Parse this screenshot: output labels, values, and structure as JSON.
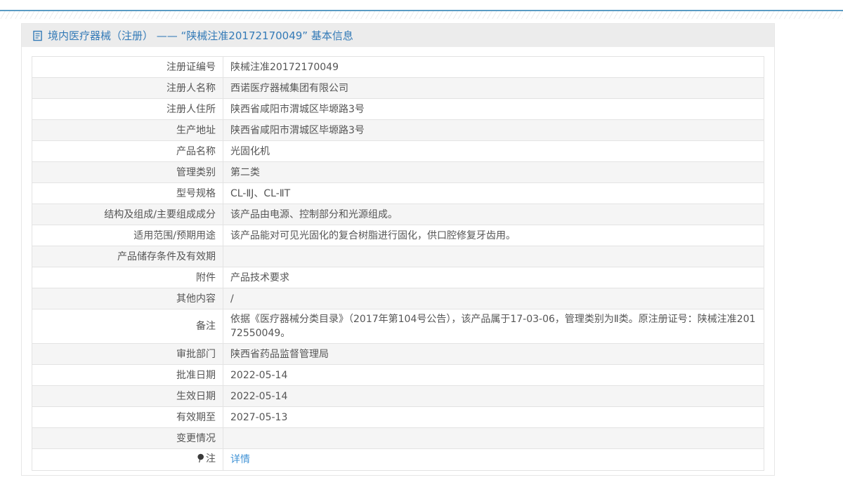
{
  "header": {
    "title": "境内医疗器械（注册） —— “陕械注准20172170049” 基本信息",
    "icon": "document-icon"
  },
  "table": {
    "rows": [
      {
        "label": "注册证编号",
        "value": "陕械注准20172170049"
      },
      {
        "label": "注册人名称",
        "value": "西诺医疗器械集团有限公司"
      },
      {
        "label": "注册人住所",
        "value": "陕西省咸阳市渭城区毕塬路3号"
      },
      {
        "label": "生产地址",
        "value": "陕西省咸阳市渭城区毕塬路3号"
      },
      {
        "label": "产品名称",
        "value": "光固化机"
      },
      {
        "label": "管理类别",
        "value": "第二类"
      },
      {
        "label": "型号规格",
        "value": "CL-ⅡJ、CL-ⅡT"
      },
      {
        "label": "结构及组成/主要组成成分",
        "value": "该产品由电源、控制部分和光源组成。"
      },
      {
        "label": "适用范围/预期用途",
        "value": "该产品能对可见光固化的复合树脂进行固化，供口腔修复牙齿用。"
      },
      {
        "label": "产品储存条件及有效期",
        "value": ""
      },
      {
        "label": "附件",
        "value": "产品技术要求"
      },
      {
        "label": "其他内容",
        "value": "/"
      },
      {
        "label": "备注",
        "value": "依据《医疗器械分类目录》（2017年第104号公告），该产品属于17-03-06，管理类别为Ⅱ类。原注册证号：陕械注准20172550049。"
      },
      {
        "label": "审批部门",
        "value": "陕西省药品监督管理局"
      },
      {
        "label": "批准日期",
        "value": "2022-05-14"
      },
      {
        "label": "生效日期",
        "value": "2022-05-14"
      },
      {
        "label": "有效期至",
        "value": "2027-05-13"
      },
      {
        "label": "变更情况",
        "value": ""
      },
      {
        "label": "注",
        "icon": "note-balloon-icon",
        "value": "详情",
        "link": true
      }
    ]
  },
  "colors": {
    "accent_blue": "#337ab7",
    "link_blue": "#4193d6",
    "titlebar_bg": "#ececec",
    "row_alt_bg": "#f5f5f5",
    "cell_border": "#e3e3e3",
    "top_line_blue": "#5b9bc4",
    "text_gray": "#555555"
  }
}
